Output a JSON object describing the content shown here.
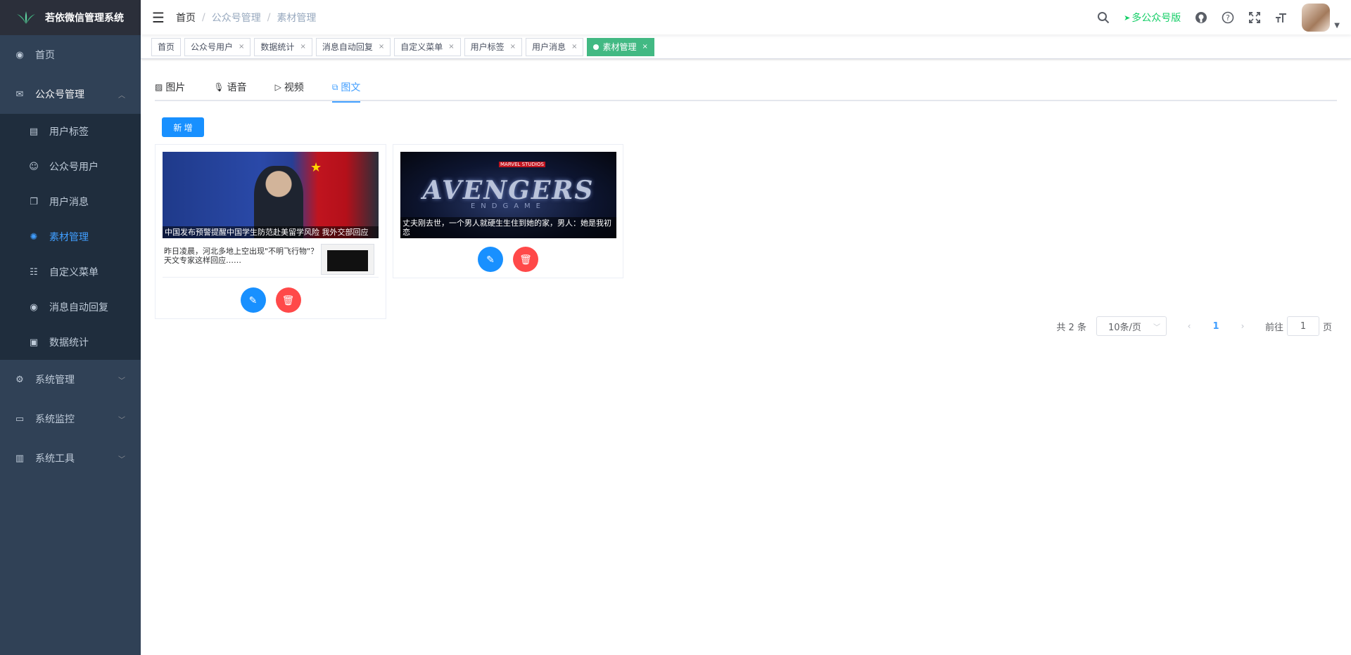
{
  "sidebar": {
    "title": "若依微信管理系统",
    "items": [
      {
        "label": "首页",
        "icon": "dashboard-icon"
      },
      {
        "label": "公众号管理",
        "icon": "wechat-icon",
        "arrow": "up"
      },
      {
        "label": "系统管理",
        "icon": "gear-icon",
        "arrow": "down"
      },
      {
        "label": "系统监控",
        "icon": "monitor-icon",
        "arrow": "down"
      },
      {
        "label": "系统工具",
        "icon": "toolbox-icon",
        "arrow": "down"
      }
    ],
    "submenu": [
      {
        "label": "用户标签",
        "icon": "tag-icon"
      },
      {
        "label": "公众号用户",
        "icon": "user-icon"
      },
      {
        "label": "用户消息",
        "icon": "message-icon"
      },
      {
        "label": "素材管理",
        "icon": "material-icon"
      },
      {
        "label": "自定义菜单",
        "icon": "tree-icon"
      },
      {
        "label": "消息自动回复",
        "icon": "reply-icon"
      },
      {
        "label": "数据统计",
        "icon": "chart-icon"
      }
    ],
    "active": "素材管理"
  },
  "header": {
    "breadcrumb": [
      "首页",
      "公众号管理",
      "素材管理"
    ],
    "multi_account_link": "多公众号版"
  },
  "tags": [
    "首页",
    "公众号用户",
    "数据统计",
    "消息自动回复",
    "自定义菜单",
    "用户标签",
    "用户消息",
    "素材管理"
  ],
  "tabs": [
    {
      "label": "图片",
      "icon": "image-icon"
    },
    {
      "label": "语音",
      "icon": "microphone-icon"
    },
    {
      "label": "视频",
      "icon": "play-icon"
    },
    {
      "label": "图文",
      "icon": "article-icon",
      "active": true
    }
  ],
  "add_button": "新 增",
  "cards": [
    {
      "cover_title": "中国发布预警提醒中国学生防范赴美留学风险 我外交部回应",
      "sub_text": "昨日凌晨，河北多地上空出现\"不明飞行物\"？天文专家这样回应……"
    },
    {
      "cover_title": "丈夫刚去世，一个男人就硬生生住到她的家，男人：她是我初恋",
      "cover_logo": "AVENGERS",
      "cover_sub": "ENDGAME",
      "cover_badge": "MARVEL STUDIOS"
    }
  ],
  "pagination": {
    "total": "共 2 条",
    "page_size": "10条/页",
    "current": "1",
    "goto_prefix": "前往",
    "goto_value": "1",
    "goto_suffix": "页"
  },
  "colors": {
    "sidebar_bg": "#304156",
    "accent": "#409eff",
    "active_tag": "#42b983",
    "danger": "#ff4949"
  }
}
